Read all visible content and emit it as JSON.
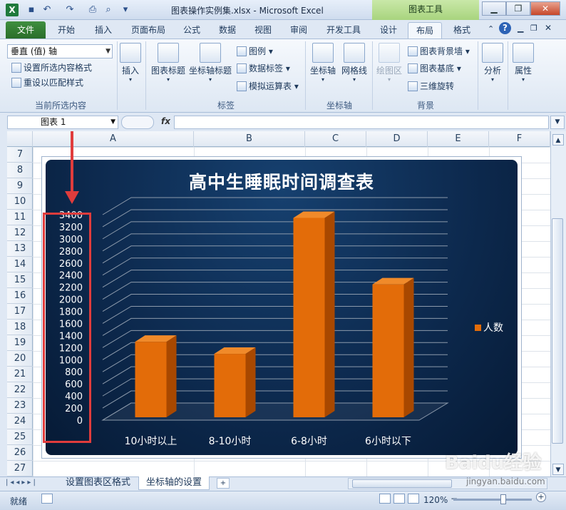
{
  "window": {
    "title": "图表操作实例集.xlsx - Microsoft Excel",
    "context_tool_title": "图表工具"
  },
  "tabs": [
    "文件",
    "开始",
    "插入",
    "页面布局",
    "公式",
    "数据",
    "视图",
    "审阅",
    "开发工具",
    "设计",
    "布局",
    "格式"
  ],
  "ribbon": {
    "current_selection": {
      "combo_value": "垂直 (值) 轴",
      "format_selection": "设置所选内容格式",
      "reset_style": "重设以匹配样式",
      "group_label": "当前所选内容"
    },
    "insert": {
      "label": "插入"
    },
    "labels_group": {
      "chart_title": "图表标题",
      "axis_title": "坐标轴标题",
      "legend": "图例",
      "data_labels": "数据标签",
      "data_table": "模拟运算表",
      "group_label": "标签"
    },
    "axes_group": {
      "axes": "坐标轴",
      "gridlines": "网格线",
      "group_label": "坐标轴"
    },
    "background_group": {
      "plot_area": "绘图区",
      "chart_wall": "图表背景墙",
      "chart_floor": "图表基底",
      "rotation": "三维旋转",
      "group_label": "背景"
    },
    "analysis": {
      "label": "分析"
    },
    "properties": {
      "label": "属性"
    }
  },
  "formula_bar": {
    "name_box": "图表 1",
    "fx": "fx",
    "value": ""
  },
  "grid": {
    "columns": [
      "A",
      "B",
      "C",
      "D",
      "E",
      "F"
    ],
    "rows": [
      "7",
      "8",
      "9",
      "10",
      "11",
      "12",
      "13",
      "14",
      "15",
      "16",
      "17",
      "18",
      "19",
      "20",
      "21",
      "22",
      "23",
      "24",
      "25",
      "26",
      "27"
    ]
  },
  "chart_data": {
    "type": "bar",
    "title": "高中生睡眠时间调查表",
    "categories": [
      "10小时以上",
      "8-10小时",
      "6-8小时",
      "6小时以下"
    ],
    "series": [
      {
        "name": "人数",
        "values": [
          1250,
          1050,
          3300,
          2200
        ]
      }
    ],
    "ylim": [
      0,
      3400
    ],
    "yticks": [
      "3400",
      "3200",
      "3000",
      "2800",
      "2600",
      "2400",
      "2200",
      "2000",
      "1800",
      "1600",
      "1400",
      "1200",
      "1000",
      "800",
      "600",
      "400",
      "200",
      "0"
    ],
    "legend_position": "right",
    "grid": true,
    "style": "3d-column",
    "bar_color": "#e36c09",
    "background_color": "#0d2a4f"
  },
  "sheet_tabs": [
    "设置图表区格式",
    "坐标轴的设置"
  ],
  "status": {
    "ready": "就绪",
    "zoom": "120%"
  },
  "watermark": {
    "main": "Baidu经验",
    "sub": "jingyan.baidu.com"
  }
}
